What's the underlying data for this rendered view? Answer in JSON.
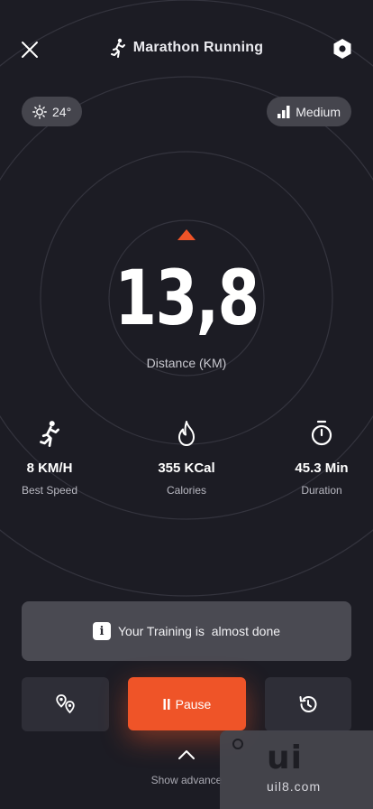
{
  "header": {
    "title": "Marathon Running",
    "close_icon": "close-icon",
    "activity_icon": "running-person-icon",
    "settings_icon": "hexagon-settings-icon"
  },
  "chips": {
    "temperature": "24°",
    "temperature_icon": "sun-icon",
    "intensity": "Medium",
    "intensity_icon": "signal-bars-icon"
  },
  "distance": {
    "value": "13,8",
    "label": "Distance (KM)"
  },
  "stats": [
    {
      "icon": "running-person-icon",
      "value": "8 KM/H",
      "label": "Best Speed"
    },
    {
      "icon": "flame-icon",
      "value": "355 KCal",
      "label": "Calories"
    },
    {
      "icon": "stopwatch-icon",
      "value": "45.3 Min",
      "label": "Duration"
    }
  ],
  "notice": {
    "text": "Your Training is  almost done",
    "icon_letter": "i"
  },
  "controls": {
    "map_icon": "location-pins-icon",
    "pause_label": "Pause",
    "history_icon": "history-icon",
    "show_advanced": "Show advance"
  },
  "watermark": {
    "brand": "ui",
    "url": "uil8.com"
  },
  "colors": {
    "background": "#1c1c24",
    "accent": "#ef5428",
    "card": "#2e2e37",
    "chip": "#45454d"
  }
}
